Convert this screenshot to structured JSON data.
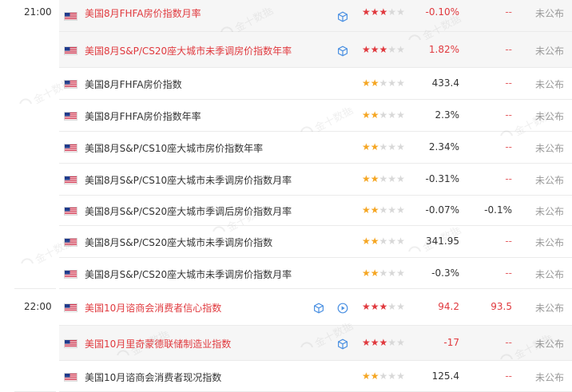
{
  "colors": {
    "accent_red": "#e0393e",
    "star_gold": "#f5a623",
    "muted": "#999999",
    "divider": "#ebebeb"
  },
  "watermark_text": "金十数据",
  "rows": [
    {
      "time": "21:00",
      "name": "美国8月FHFA房价指数月率",
      "name_red": true,
      "icons": [
        "cube-icon"
      ],
      "stars": 3,
      "actual": "-0.10%",
      "actual_red": true,
      "forecast": "--",
      "status": "未公布",
      "highlight": true
    },
    {
      "time": "",
      "name": "美国8月S&P/CS20座大城市未季调房价指数年率",
      "name_red": true,
      "icons": [
        "cube-icon"
      ],
      "stars": 3,
      "actual": "1.82%",
      "actual_red": true,
      "forecast": "--",
      "status": "未公布",
      "highlight": true
    },
    {
      "time": "",
      "name": "美国8月FHFA房价指数",
      "name_red": false,
      "icons": [],
      "stars": 2,
      "actual": "433.4",
      "actual_red": false,
      "forecast": "--",
      "status": "未公布",
      "highlight": false
    },
    {
      "time": "",
      "name": "美国8月FHFA房价指数年率",
      "name_red": false,
      "icons": [],
      "stars": 2,
      "actual": "2.3%",
      "actual_red": false,
      "forecast": "--",
      "status": "未公布",
      "highlight": false
    },
    {
      "time": "",
      "name": "美国8月S&P/CS10座大城市房价指数年率",
      "name_red": false,
      "icons": [],
      "stars": 2,
      "actual": "2.34%",
      "actual_red": false,
      "forecast": "--",
      "status": "未公布",
      "highlight": false
    },
    {
      "time": "",
      "name": "美国8月S&P/CS10座大城市未季调房价指数月率",
      "name_red": false,
      "icons": [],
      "stars": 2,
      "actual": "-0.31%",
      "actual_red": false,
      "forecast": "--",
      "status": "未公布",
      "highlight": false
    },
    {
      "time": "",
      "name": "美国8月S&P/CS20座大城市季调后房价指数月率",
      "name_red": false,
      "icons": [],
      "stars": 2,
      "actual": "-0.07%",
      "actual_red": false,
      "forecast": "-0.1%",
      "status": "未公布",
      "highlight": false
    },
    {
      "time": "",
      "name": "美国8月S&P/CS20座大城市未季调房价指数",
      "name_red": false,
      "icons": [],
      "stars": 2,
      "actual": "341.95",
      "actual_red": false,
      "forecast": "--",
      "status": "未公布",
      "highlight": false
    },
    {
      "time": "",
      "name": "美国8月S&P/CS20座大城市未季调房价指数月率",
      "name_red": false,
      "icons": [],
      "stars": 2,
      "actual": "-0.3%",
      "actual_red": false,
      "forecast": "--",
      "status": "未公布",
      "highlight": false
    },
    {
      "time": "22:00",
      "name": "美国10月谘商会消费者信心指数",
      "name_red": true,
      "icons": [
        "cube-icon",
        "play-icon"
      ],
      "stars": 3,
      "actual": "94.2",
      "actual_red": true,
      "forecast": "93.5",
      "status": "未公布",
      "highlight": false
    },
    {
      "time": "",
      "name": "美国10月里奇蒙德联储制造业指数",
      "name_red": true,
      "icons": [
        "cube-icon"
      ],
      "stars": 3,
      "actual": "-17",
      "actual_red": true,
      "forecast": "--",
      "status": "未公布",
      "highlight": true
    },
    {
      "time": "",
      "name": "美国10月谘商会消费者现况指数",
      "name_red": false,
      "icons": [],
      "stars": 2,
      "actual": "125.4",
      "actual_red": false,
      "forecast": "--",
      "status": "未公布",
      "highlight": false
    }
  ]
}
